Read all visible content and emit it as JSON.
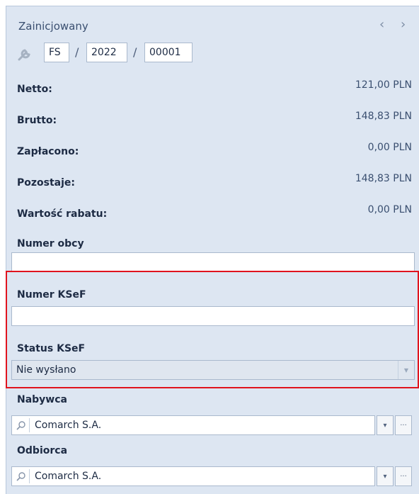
{
  "header": {
    "status": "Zainicjowany",
    "nav_prev": "‹",
    "nav_next": "›",
    "icon": "wrench-icon"
  },
  "doc_number": {
    "series": "FS",
    "sep1": "/",
    "year": "2022",
    "sep2": "/",
    "number": "00001"
  },
  "summary": [
    {
      "label": "Netto:",
      "value": "121,00 PLN"
    },
    {
      "label": "Brutto:",
      "value": "148,83 PLN"
    },
    {
      "label": "Zapłacono:",
      "value": "0,00 PLN"
    },
    {
      "label": "Pozostaje:",
      "value": "148,83 PLN"
    },
    {
      "label": "Wartość rabatu:",
      "value": "0,00 PLN"
    }
  ],
  "numer_obcy": {
    "label": "Numer obcy",
    "value": ""
  },
  "ksef": {
    "number_label": "Numer KSeF",
    "number_value": "",
    "status_label": "Status KSeF",
    "status_value": "Nie wysłano"
  },
  "nabywca": {
    "label": "Nabywca",
    "value": "Comarch S.A.",
    "dropdown": "▾",
    "more": "···"
  },
  "odbiorca": {
    "label": "Odbiorca",
    "value": "Comarch S.A.",
    "dropdown": "▾",
    "more": "···"
  },
  "colors": {
    "panel": "#dde6f2",
    "highlight": "#e0141e"
  }
}
